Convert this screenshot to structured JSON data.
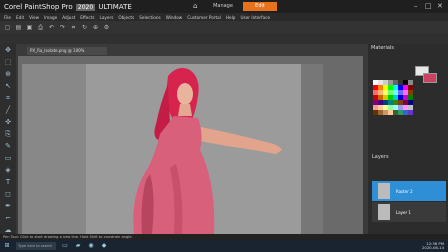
{
  "app": {
    "brand": "Corel PaintShop Pro",
    "version": "2020",
    "edition": "ULTIMATE",
    "workspace_tabs": [
      "Manage",
      "Edit"
    ],
    "window_controls": [
      "–",
      "□",
      "✕"
    ]
  },
  "menu": [
    "File",
    "Edit",
    "View",
    "Image",
    "Adjust",
    "Effects",
    "Layers",
    "Objects",
    "Selections",
    "Window",
    "Customer Portal",
    "Help",
    "User Interface"
  ],
  "toolbar_icons": [
    "new-icon",
    "open-icon",
    "save-icon",
    "print-icon",
    "undo-icon",
    "redo-icon",
    "crop-icon",
    "rotate-icon",
    "zoom-icon",
    "settings-icon"
  ],
  "document_tab": "PX_Ra_Isolate.png @ 100%",
  "tools": [
    "pan-icon",
    "select-icon",
    "zoom-icon",
    "pick-icon",
    "crop-icon",
    "straighten-icon",
    "move-icon",
    "clone-icon",
    "brush-icon",
    "eraser-icon",
    "fill-icon",
    "text-icon",
    "shape-icon",
    "pen-icon",
    "dropper-icon",
    "smudge-icon",
    "retouch-icon",
    "warp-icon"
  ],
  "panels": {
    "materials_title": "Materials",
    "layers_title": "Layers",
    "layers": [
      {
        "name": "Raster 2",
        "selected": true
      },
      {
        "name": "Layer 1",
        "selected": false
      }
    ],
    "fg_color": "#e7e7e7",
    "bg_color": "#c94262"
  },
  "swatch_colors": [
    "#ffffff",
    "#e6e6e6",
    "#cccccc",
    "#999999",
    "#666666",
    "#333333",
    "#000000",
    "#8a8a8a",
    "#ff0000",
    "#ff8000",
    "#ffff00",
    "#00ff00",
    "#00ffff",
    "#0000ff",
    "#ff00ff",
    "#800000",
    "#ff6b6b",
    "#ffb36b",
    "#ffff6b",
    "#6bff6b",
    "#6bffff",
    "#6b6bff",
    "#ff6bff",
    "#804000",
    "#cc0000",
    "#cc6600",
    "#cccc00",
    "#00cc00",
    "#00cccc",
    "#0000cc",
    "#cc00cc",
    "#008000",
    "#800080",
    "#400080",
    "#004080",
    "#008080",
    "#408000",
    "#804000",
    "#800040",
    "#000080",
    "#ff9999",
    "#ffcc99",
    "#ffff99",
    "#99ff99",
    "#99ffff",
    "#9999ff",
    "#ff99ff",
    "#c0c0c0",
    "#663300",
    "#996633",
    "#cc9966",
    "#ffcc99",
    "#336633",
    "#339966",
    "#3366cc",
    "#6633cc"
  ],
  "status_text": "Pen Tool: Click to start drawing a new line. Hold Shift to constrain angle.",
  "taskbar": {
    "search_placeholder": "Type here to search",
    "time": "12:36 PM",
    "date": "2020-06-14"
  }
}
